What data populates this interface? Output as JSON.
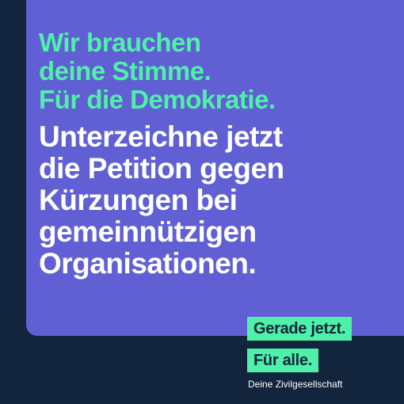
{
  "poster": {
    "headline_green": [
      "Wir brauchen",
      "deine Stimme.",
      "Für die Demokratie."
    ],
    "headline_white": [
      "Unterzeichne jetzt",
      "die Petition gegen",
      "Kürzungen bei",
      "gemeinnützigen",
      "Organisationen."
    ],
    "tags": [
      "Gerade jetzt.",
      "Für alle."
    ],
    "signature": "Deine Zivilgesellschaft"
  },
  "colors": {
    "background": "#13253d",
    "card": "#6060d4",
    "accent_green": "#4ff0a8",
    "text_white": "#ffffff"
  }
}
